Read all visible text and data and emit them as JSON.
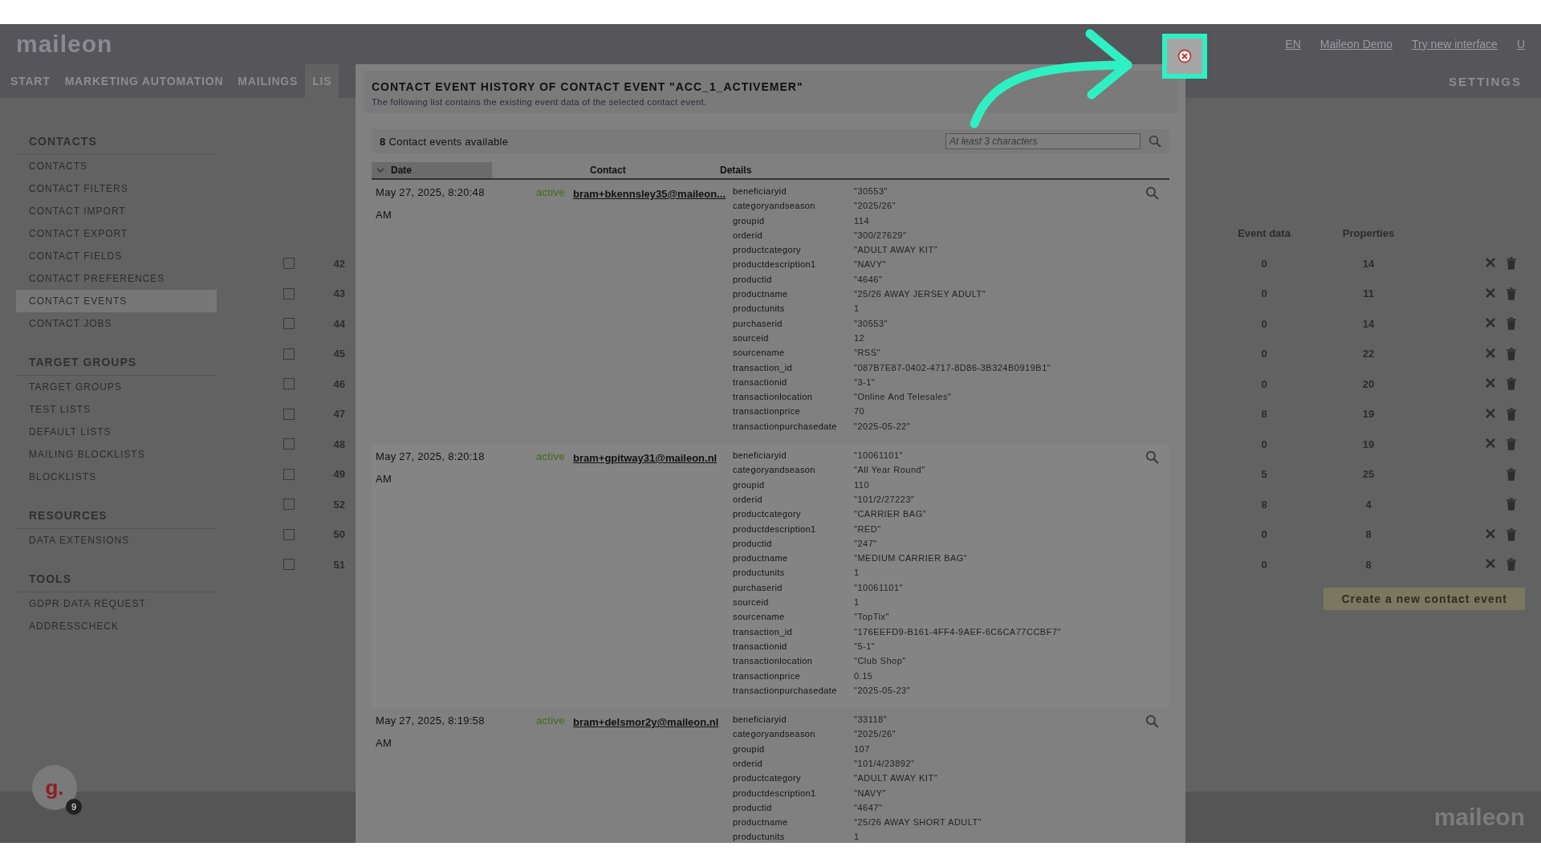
{
  "app": {
    "logo": "maileon",
    "top_links": [
      "EN",
      "Maileon Demo",
      "Try new interface",
      "U"
    ],
    "nav": [
      {
        "label": "START",
        "selected": false
      },
      {
        "label": "MARKETING AUTOMATION",
        "selected": false
      },
      {
        "label": "MAILINGS",
        "selected": false
      },
      {
        "label": "LIS",
        "selected": true
      }
    ],
    "nav_right": "SETTINGS",
    "sidebar": [
      {
        "heading": "CONTACTS",
        "items": [
          {
            "label": "CONTACTS",
            "selected": false
          },
          {
            "label": "CONTACT FILTERS",
            "selected": false
          },
          {
            "label": "CONTACT IMPORT",
            "selected": false
          },
          {
            "label": "CONTACT EXPORT",
            "selected": false
          },
          {
            "label": "CONTACT FIELDS",
            "selected": false
          },
          {
            "label": "CONTACT PREFERENCES",
            "selected": false
          },
          {
            "label": "CONTACT EVENTS",
            "selected": true
          },
          {
            "label": "CONTACT JOBS",
            "selected": false
          }
        ]
      },
      {
        "heading": "TARGET GROUPS",
        "items": [
          {
            "label": "TARGET GROUPS",
            "selected": false
          },
          {
            "label": "TEST LISTS",
            "selected": false
          },
          {
            "label": "DEFAULT LISTS",
            "selected": false
          },
          {
            "label": "MAILING BLOCKLISTS",
            "selected": false
          },
          {
            "label": "BLOCKLISTS",
            "selected": false
          }
        ]
      },
      {
        "heading": "RESOURCES",
        "items": [
          {
            "label": "DATA EXTENSIONS",
            "selected": false
          }
        ]
      },
      {
        "heading": "TOOLS",
        "items": [
          {
            "label": "GDPR DATA REQUEST",
            "selected": false
          },
          {
            "label": "ADDRESSCHECK",
            "selected": false
          }
        ]
      }
    ],
    "table": {
      "columns": [
        "Event data",
        "Properties"
      ],
      "rows": [
        {
          "checked": false,
          "number": "42",
          "event_data": "0",
          "properties": "14",
          "deletable": true
        },
        {
          "checked": false,
          "number": "43",
          "event_data": "0",
          "properties": "11",
          "deletable": true
        },
        {
          "checked": false,
          "number": "44",
          "event_data": "0",
          "properties": "14",
          "deletable": true
        },
        {
          "checked": false,
          "number": "45",
          "event_data": "0",
          "properties": "22",
          "deletable": true
        },
        {
          "checked": false,
          "number": "46",
          "event_data": "0",
          "properties": "20",
          "deletable": true
        },
        {
          "checked": false,
          "number": "47",
          "event_data": "8",
          "properties": "19",
          "deletable": true
        },
        {
          "checked": false,
          "number": "48",
          "event_data": "0",
          "properties": "19",
          "deletable": true
        },
        {
          "checked": false,
          "number": "49",
          "event_data": "5",
          "properties": "25",
          "deletable": false
        },
        {
          "checked": false,
          "number": "52",
          "event_data": "8",
          "properties": "4",
          "deletable": false
        },
        {
          "checked": false,
          "number": "50",
          "event_data": "0",
          "properties": "8",
          "deletable": true
        },
        {
          "checked": false,
          "number": "51",
          "event_data": "0",
          "properties": "8",
          "deletable": true
        }
      ]
    },
    "create_button": "Create a new contact event",
    "footer_logo": "maileon",
    "assistant": {
      "letter": "g.",
      "badge": "9"
    }
  },
  "dialog": {
    "title": "CONTACT EVENT HISTORY OF CONTACT EVENT \"ACC_1_ACTIVEMER\"",
    "subtitle": "The following list contains the existing event data of the selected contact event.",
    "count": "8",
    "count_label": "Contact events available",
    "search": {
      "placeholder": "At least 3 characters"
    },
    "columns": [
      {
        "label": "Date",
        "sorted": true
      },
      {
        "label": "Contact",
        "sorted": false
      },
      {
        "label": "Details",
        "sorted": false
      }
    ],
    "events": [
      {
        "date": "May 27, 2025, 8:20:48",
        "time_suffix": "AM",
        "status": "active",
        "contact": "bram+bkennsley35@maileon...",
        "details": [
          [
            "beneficiaryid",
            "\"30553\""
          ],
          [
            "categoryandseason",
            "\"2025/26\""
          ],
          [
            "groupid",
            "114"
          ],
          [
            "orderid",
            "\"300/27629\""
          ],
          [
            "productcategory",
            "\"ADULT AWAY KIT\""
          ],
          [
            "productdescription1",
            "\"NAVY\""
          ],
          [
            "productid",
            "\"4646\""
          ],
          [
            "productname",
            "\"25/26 AWAY JERSEY ADULT\""
          ],
          [
            "productunits",
            "1"
          ],
          [
            "purchaserid",
            "\"30553\""
          ],
          [
            "sourceid",
            "12"
          ],
          [
            "sourcename",
            "\"RSS\""
          ],
          [
            "transaction_id",
            "\"087B7E87-0402-4717-8D86-3B324B0919B1\""
          ],
          [
            "transactionid",
            "\"3-1\""
          ],
          [
            "transactionlocation",
            "\"Online And Telesales\""
          ],
          [
            "transactionprice",
            "70"
          ],
          [
            "transactionpurchasedate",
            "\"2025-05-22\""
          ]
        ]
      },
      {
        "date": "May 27, 2025, 8:20:18",
        "time_suffix": "AM",
        "status": "active",
        "contact": "bram+gpitway31@maileon.nl",
        "details": [
          [
            "beneficiaryid",
            "\"10061101\""
          ],
          [
            "categoryandseason",
            "\"All Year Round\""
          ],
          [
            "groupid",
            "110"
          ],
          [
            "orderid",
            "\"101/2/27223\""
          ],
          [
            "productcategory",
            "\"CARRIER BAG\""
          ],
          [
            "productdescription1",
            "\"RED\""
          ],
          [
            "productid",
            "\"247\""
          ],
          [
            "productname",
            "\"MEDIUM CARRIER BAG\""
          ],
          [
            "productunits",
            "1"
          ],
          [
            "purchaserid",
            "\"10061101\""
          ],
          [
            "sourceid",
            "1"
          ],
          [
            "sourcename",
            "\"TopTix\""
          ],
          [
            "transaction_id",
            "\"176EEFD9-B161-4FF4-9AEF-6C6CA77CCBF7\""
          ],
          [
            "transactionid",
            "\"5-1\""
          ],
          [
            "transactionlocation",
            "\"Club Shop\""
          ],
          [
            "transactionprice",
            "0.15"
          ],
          [
            "transactionpurchasedate",
            "\"2025-05-23\""
          ]
        ]
      },
      {
        "date": "May 27, 2025, 8:19:58",
        "time_suffix": "AM",
        "status": "active",
        "contact": "bram+delsmor2y@maileon.nl",
        "details": [
          [
            "beneficiaryid",
            "\"33118\""
          ],
          [
            "categoryandseason",
            "\"2025/26\""
          ],
          [
            "groupid",
            "107"
          ],
          [
            "orderid",
            "\"101/4/23892\""
          ],
          [
            "productcategory",
            "\"ADULT AWAY KIT\""
          ],
          [
            "productdescription1",
            "\"NAVY\""
          ],
          [
            "productid",
            "\"4647\""
          ],
          [
            "productname",
            "\"25/26 AWAY SHORT ADULT\""
          ],
          [
            "productunits",
            "1"
          ]
        ]
      }
    ]
  }
}
